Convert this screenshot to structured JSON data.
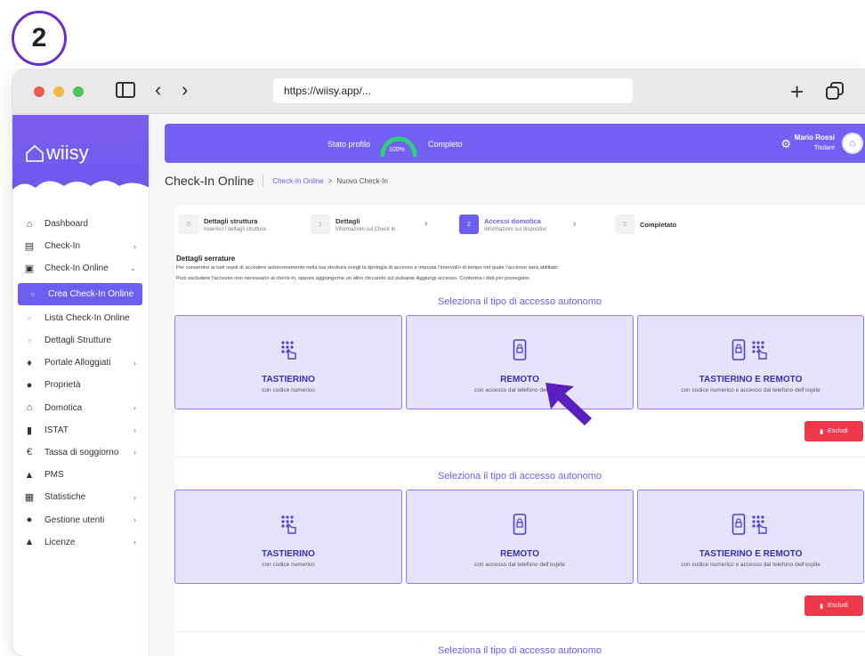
{
  "step_badge": "2",
  "browser": {
    "url": "https://wiisy.app/...",
    "traffic_colors": [
      "#ee5a52",
      "#f5b94a",
      "#4fc35a"
    ]
  },
  "sidebar": {
    "logo_text": "wiisy",
    "items": [
      {
        "label": "Dashboard",
        "icon": "home-icon",
        "chevron": false
      },
      {
        "label": "Check-In",
        "icon": "clipboard-icon",
        "chevron": true
      },
      {
        "label": "Check-In Online",
        "icon": "calendar-icon",
        "chevron": true,
        "expanded": true
      },
      {
        "label": "Crea Check-In Online",
        "icon": "circle-icon",
        "sub": true,
        "active": true
      },
      {
        "label": "Lista Check-In Online",
        "icon": "circle-icon",
        "sub": true
      },
      {
        "label": "Dettagli Strutture",
        "icon": "circle-icon",
        "sub": true
      },
      {
        "label": "Portale Alloggiati",
        "icon": "users-icon",
        "chevron": true
      },
      {
        "label": "Proprietà",
        "icon": "location-pin-icon",
        "chevron": false
      },
      {
        "label": "Domotica",
        "icon": "smart-home-icon",
        "chevron": true
      },
      {
        "label": "ISTAT",
        "icon": "bar-chart-icon",
        "chevron": true
      },
      {
        "label": "Tassa di soggiorno",
        "icon": "euro-icon",
        "chevron": true
      },
      {
        "label": "PMS",
        "icon": "building-icon",
        "chevron": false
      },
      {
        "label": "Statistiche",
        "icon": "table-icon",
        "chevron": true
      },
      {
        "label": "Gestione utenti",
        "icon": "user-group-icon",
        "chevron": true
      },
      {
        "label": "Licenze",
        "icon": "user-key-icon",
        "chevron": true
      }
    ]
  },
  "topbar": {
    "profile_label": "Stato profilo",
    "progress_label": "100%",
    "progress": 1.0,
    "complete_label": "Completo",
    "user_name": "Mario Rossi",
    "user_role": "Titolare"
  },
  "page": {
    "title": "Check-In Online",
    "breadcrumb_link": "Check-In Online",
    "breadcrumb_arrow": ">",
    "breadcrumb_current": "Nuovo Check-In"
  },
  "wizard": [
    {
      "num": "0",
      "title": "Dettagli struttura",
      "sub": "Inserisci i dettagli struttura",
      "active": false
    },
    {
      "num": "1",
      "title": "Dettagli",
      "sub": "Informazioni sul Check In",
      "active": false
    },
    {
      "num": "2",
      "title": "Accessi domotica",
      "sub": "Informazioni sui dispositivi",
      "active": true
    },
    {
      "num": "3",
      "title": "Completato",
      "sub": "",
      "active": false
    }
  ],
  "section": {
    "title": "Dettagli serrature",
    "desc1": "Per consentire ai tuoi ospiti di accedere autonomamente nella tua struttura scegli la tipologia di accesso e imposta l'intervallo di tempo nel quale l'accesso sarà abilitato.",
    "desc2": "Puoi escludere l'accesso non necessario al check-in, oppure aggiungerne un altro cliccando sul pulsante Aggiungi accesso. Conferma i dati per proseguire."
  },
  "blocks": [
    {
      "heading": "Seleziona il tipo di accesso autonomo",
      "options": [
        {
          "title": "TASTIERINO",
          "sub": "con codice numerico",
          "icon": "keypad-icon"
        },
        {
          "title": "REMOTO",
          "sub": "con accesso dal telefono dell'ospite",
          "icon": "phone-lock-icon"
        },
        {
          "title": "TASTIERINO E REMOTO",
          "sub": "con codice numerico e accesso dal telefono dell'ospite",
          "icon": "phone-keypad-icon"
        }
      ],
      "exclude_label": "Escludi"
    },
    {
      "heading": "Seleziona il tipo di accesso autonomo",
      "options": [
        {
          "title": "TASTIERINO",
          "sub": "con codice numerico",
          "icon": "keypad-icon"
        },
        {
          "title": "REMOTO",
          "sub": "con accesso dal telefono dell'ospite",
          "icon": "phone-lock-icon"
        },
        {
          "title": "TASTIERINO E REMOTO",
          "sub": "con codice numerico e accesso dal telefono dell'ospite",
          "icon": "phone-keypad-icon"
        }
      ],
      "exclude_label": "Escludi"
    },
    {
      "heading": "Seleziona il tipo di accesso autonomo"
    }
  ],
  "colors": {
    "accent": "#6c5ef0",
    "topbar": "#7460f2",
    "option_bg": "#e6e3ff",
    "danger": "#f0384b",
    "badge_ring": "#6b2fc9"
  }
}
